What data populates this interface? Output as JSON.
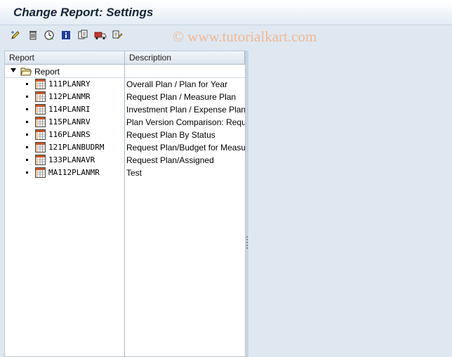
{
  "window": {
    "title": "Change Report: Settings",
    "watermark": "© www.tutorialkart.com"
  },
  "toolbar": {
    "buttons": [
      {
        "name": "change-icon"
      },
      {
        "name": "delete-icon"
      },
      {
        "name": "execute-icon"
      },
      {
        "name": "info-icon"
      },
      {
        "name": "copy-icon"
      },
      {
        "name": "transport-icon"
      },
      {
        "name": "check-icon"
      }
    ]
  },
  "table": {
    "headers": {
      "report": "Report",
      "description": "Description"
    },
    "root": {
      "label": "Report"
    },
    "rows": [
      {
        "report": "111PLANRY",
        "description": "Overall Plan / Plan for Year"
      },
      {
        "report": "112PLANMR",
        "description": "Request Plan / Measure Plan"
      },
      {
        "report": "114PLANRI",
        "description": "Investment Plan / Expense Plan"
      },
      {
        "report": "115PLANRV",
        "description": "Plan Version Comparison: Request"
      },
      {
        "report": "116PLANRS",
        "description": "Request Plan By Status"
      },
      {
        "report": "121PLANBUDRM",
        "description": "Request Plan/Budget for Measure"
      },
      {
        "report": "133PLANAVR",
        "description": "Request Plan/Assigned"
      },
      {
        "report": "MA112PLANMR",
        "description": "Test"
      }
    ]
  },
  "colors": {
    "title": "#16243a",
    "background": "#dfe8f1",
    "watermark": "#f0b792"
  }
}
